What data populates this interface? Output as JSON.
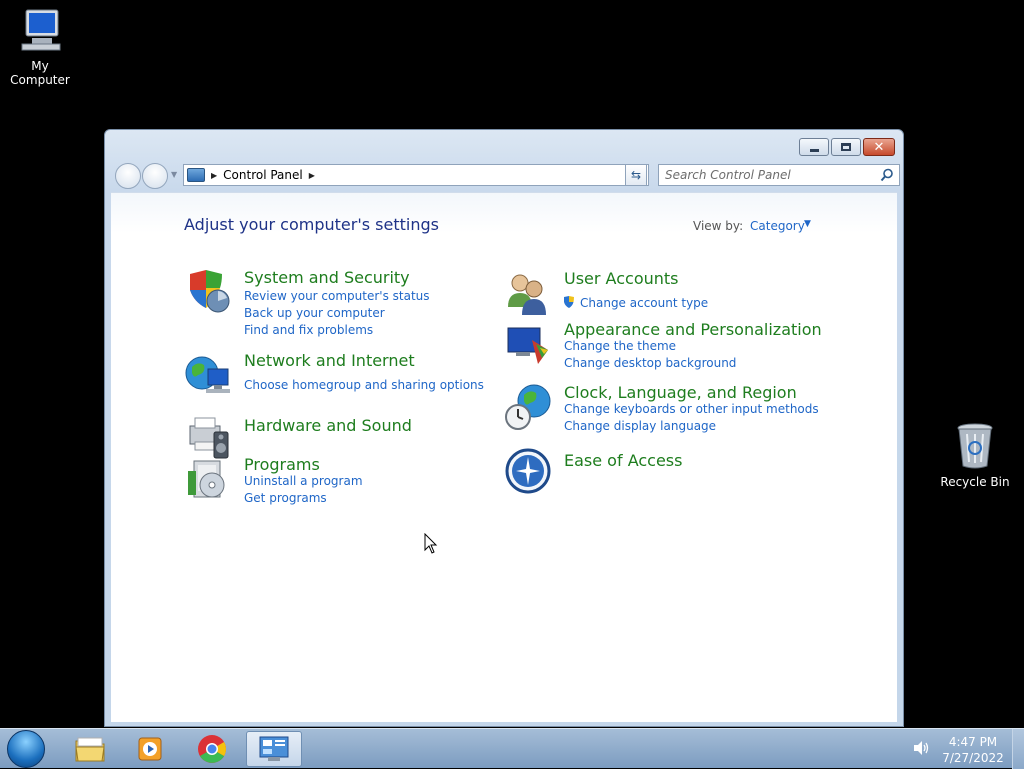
{
  "desktop": {
    "icons": [
      {
        "label": "My Computer"
      },
      {
        "label": "Recycle Bin"
      }
    ]
  },
  "window": {
    "address": {
      "crumb": "Control Panel"
    },
    "search": {
      "placeholder": "Search Control Panel"
    },
    "content": {
      "title": "Adjust your computer's settings",
      "view_by_label": "View by:",
      "view_by_value": "Category",
      "categories": [
        {
          "title": "System and Security",
          "icon": "shield-icon",
          "links": [
            "Review your computer's status",
            "Back up your computer",
            "Find and fix problems"
          ]
        },
        {
          "title": "Network and Internet",
          "icon": "globe-network-icon",
          "links": [
            "Choose homegroup and sharing options"
          ]
        },
        {
          "title": "Hardware and Sound",
          "icon": "printer-speaker-icon",
          "links": []
        },
        {
          "title": "Programs",
          "icon": "programs-icon",
          "links": [
            "Uninstall a program",
            "Get programs"
          ]
        },
        {
          "title": "User Accounts",
          "icon": "users-icon",
          "links": [
            "Change account type"
          ]
        },
        {
          "title": "Appearance and Personalization",
          "icon": "monitor-palette-icon",
          "links": [
            "Change the theme",
            "Change desktop background"
          ]
        },
        {
          "title": "Clock, Language, and Region",
          "icon": "clock-globe-icon",
          "links": [
            "Change keyboards or other input methods",
            "Change display language"
          ]
        },
        {
          "title": "Ease of Access",
          "icon": "ease-of-access-icon",
          "links": []
        }
      ]
    }
  },
  "taskbar": {
    "items": [
      "start-orb-icon",
      "folder-icon",
      "media-player-icon",
      "chrome-icon",
      "control-panel-icon"
    ],
    "time": "4:47 PM",
    "date": "7/27/2022"
  }
}
